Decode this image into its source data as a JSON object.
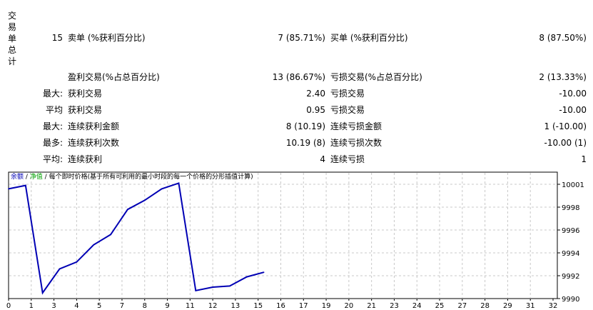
{
  "summary": {
    "title": "交易单总计",
    "rows": [
      {
        "label": "",
        "count": "15",
        "name1": "卖单 (%获利百分比)",
        "value1": "7 (85.71%)",
        "name2": "买单 (%获利百分比)",
        "value2": "8 (87.50%)"
      },
      {
        "label": "",
        "count": "",
        "name1": "盈利交易(%占总百分比)",
        "value1": "13 (86.67%)",
        "name2": "亏损交易(%占总百分比)",
        "value2": "2 (13.33%)"
      },
      {
        "label": "最大:",
        "count": "",
        "name1": "获利交易",
        "value1": "2.40",
        "name2": "亏损交易",
        "value2": "-10.00"
      },
      {
        "label": "平均",
        "count": "",
        "name1": "获利交易",
        "value1": "0.95",
        "name2": "亏损交易",
        "value2": "-10.00"
      },
      {
        "label": "最大:",
        "count": "",
        "name1": "连续获利金额",
        "value1": "8 (10.19)",
        "name2": "连续亏损金额",
        "value2": "1 (-10.00)"
      },
      {
        "label": "最多:",
        "count": "",
        "name1": "连续获利次数",
        "value1": "10.19 (8)",
        "name2": "连续亏损次数",
        "value2": "-10.00 (1)"
      },
      {
        "label": "平均:",
        "count": "",
        "name1": "连续获利",
        "value1": "4",
        "name2": "连续亏损",
        "value2": "1"
      }
    ]
  },
  "chart_data": {
    "type": "line",
    "legend": {
      "balance": "余额",
      "sep1": " / ",
      "equity": "净值",
      "sep2": " / ",
      "desc": "每个即时价格(基于所有可利用的最小时段的每一个价格的分形插值计算)"
    },
    "colors": {
      "balance": "#0000b4",
      "equity": "#00a000",
      "grid": "#c8c8c8"
    },
    "x_tick_labels": [
      "0",
      "1",
      "3",
      "4",
      "5",
      "7",
      "8",
      "9",
      "11",
      "12",
      "13",
      "15",
      "16",
      "17",
      "19",
      "20",
      "21",
      "23",
      "24",
      "25",
      "27",
      "28",
      "29",
      "31",
      "32"
    ],
    "y_tick_labels": [
      "9990",
      "9992",
      "9994",
      "9996",
      "9998",
      "10001"
    ],
    "xlim": [
      0,
      32
    ],
    "ylim": [
      9990,
      10000
    ],
    "series": [
      {
        "name": "余额",
        "x": [
          0,
          1,
          2,
          3,
          4,
          5,
          6,
          7,
          8,
          9,
          10,
          11,
          12,
          13,
          14,
          15
        ],
        "y": [
          9999.6,
          9999.9,
          9990.5,
          9992.6,
          9993.2,
          9994.7,
          9995.6,
          9997.8,
          9998.6,
          9999.6,
          10000.1,
          9990.7,
          9991.0,
          9991.1,
          9991.9,
          9992.3
        ]
      }
    ]
  }
}
